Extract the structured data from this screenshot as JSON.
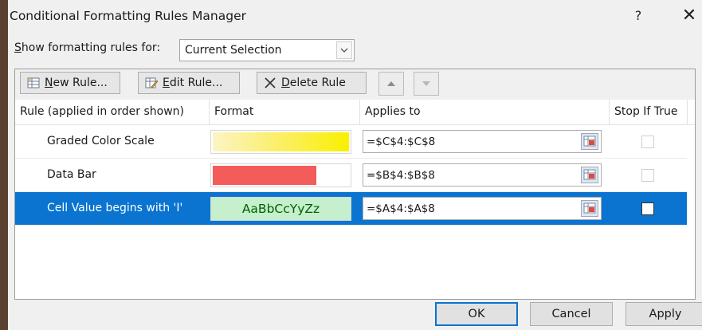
{
  "window": {
    "title": "Conditional Formatting Rules Manager",
    "help_label": "?",
    "close_label": "✕"
  },
  "filter": {
    "label_prefix": "S",
    "label_rest": "how formatting rules for:",
    "selected_value": "Current Selection"
  },
  "toolbar": {
    "new_rule_mnemonic": "N",
    "new_rule_rest": "ew Rule...",
    "edit_rule_mnemonic": "E",
    "edit_rule_rest": "dit Rule...",
    "delete_rule_mnemonic": "D",
    "delete_rule_rest": "elete Rule"
  },
  "table": {
    "headers": {
      "rule": "Rule (applied in order shown)",
      "format": "Format",
      "applies_to": "Applies to",
      "stop_if_true": "Stop If True"
    },
    "rows": [
      {
        "name": "Graded Color Scale",
        "format_type": "color-scale",
        "applies_to": "=$C$4:$C$8",
        "stop_if_true": false,
        "selected": false
      },
      {
        "name": "Data Bar",
        "format_type": "data-bar",
        "applies_to": "=$B$4:$B$8",
        "stop_if_true": false,
        "selected": false
      },
      {
        "name": "Cell Value begins with 'I'",
        "format_type": "text-sample",
        "format_sample": "AaBbCcYyZz",
        "applies_to": "=$A$4:$A$8",
        "stop_if_true": false,
        "selected": true
      }
    ]
  },
  "footer": {
    "ok_label": "OK",
    "cancel_label": "Cancel",
    "apply_label": "Apply"
  },
  "colors": {
    "selection": "#0a74d0",
    "data_bar": "#f45b5b",
    "sample_fill": "#c6efce",
    "sample_text": "#006100",
    "scale_end": "#f9f000"
  }
}
